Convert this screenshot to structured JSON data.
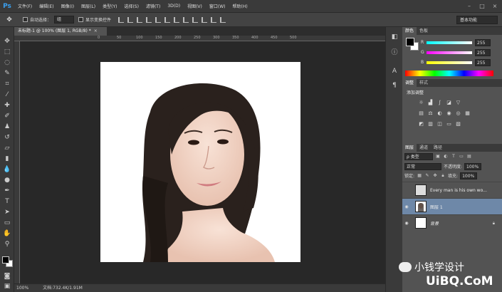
{
  "app": {
    "logo": "Ps"
  },
  "menus": [
    "文件(F)",
    "编辑(E)",
    "图像(I)",
    "图层(L)",
    "类型(Y)",
    "选择(S)",
    "滤镜(T)",
    "3D(D)",
    "视图(V)",
    "窗口(W)",
    "帮助(H)"
  ],
  "options": {
    "auto_select_label": "自动选择：",
    "auto_select_value": "组",
    "show_transform_label": "显示变换控件",
    "workspace": "基本功能"
  },
  "document": {
    "tab_title": "未标题-1 @ 100% (图层 1, RGB/8) *",
    "tab_close": "×"
  },
  "ruler": {
    "marks": [
      "0",
      "50",
      "100",
      "150",
      "200",
      "250",
      "300",
      "350",
      "400",
      "450",
      "500"
    ]
  },
  "status": {
    "zoom": "100%",
    "doc_size": "文档:732.4K/1.91M"
  },
  "color_panel": {
    "tabs": [
      "颜色",
      "色板"
    ],
    "channels": [
      {
        "label": "R",
        "value": "255",
        "track": "linear-gradient(to right,#00ffff,#ffffff)"
      },
      {
        "label": "G",
        "value": "255",
        "track": "linear-gradient(to right,#ff00ff,#ffffff)"
      },
      {
        "label": "B",
        "value": "255",
        "track": "linear-gradient(to right,#ffff00,#ffffff)"
      }
    ]
  },
  "adjustments": {
    "tabs": [
      "调整",
      "样式"
    ],
    "title": "添加调整"
  },
  "layers_panel": {
    "tabs": [
      "图层",
      "通道",
      "路径"
    ],
    "filter_kind": "ρ 类型",
    "blend_mode": "正常",
    "opacity_label": "不透明度:",
    "opacity_value": "100%",
    "lock_label": "锁定:",
    "fill_label": "填充:",
    "fill_value": "100%",
    "layers": [
      {
        "name": "Every man is his own wo...",
        "visible": false,
        "selected": false
      },
      {
        "name": "图层 1",
        "visible": true,
        "selected": true
      },
      {
        "name": "背景",
        "visible": true,
        "selected": false,
        "locked": true
      }
    ]
  },
  "watermark": {
    "text": "小钱学设计",
    "site": "UiBQ.CoM"
  }
}
